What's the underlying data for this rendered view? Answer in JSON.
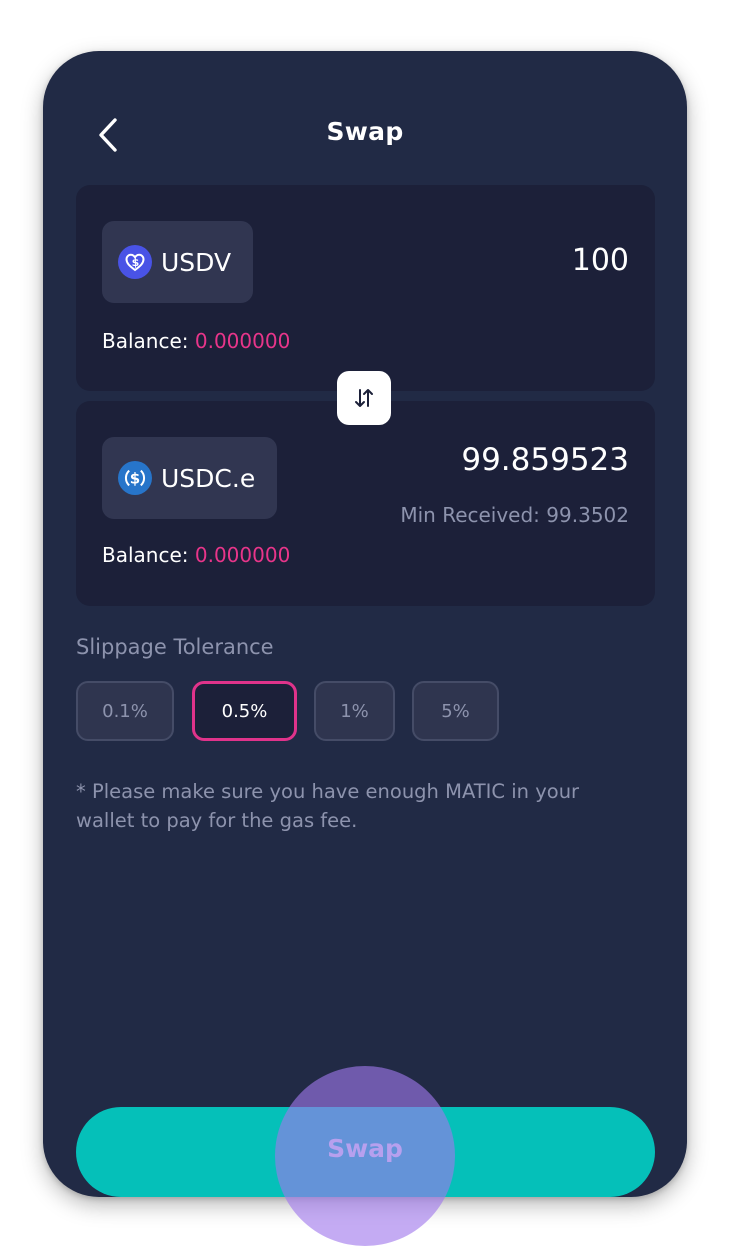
{
  "header": {
    "title": "Swap",
    "back_icon": "chevron-left-icon"
  },
  "from_token": {
    "symbol": "USDV",
    "icon": "usdv-token-icon",
    "amount": "100",
    "balance_label": "Balance:",
    "balance_value": "0.000000"
  },
  "direction_icon": "swap-vertical-arrows-icon",
  "to_token": {
    "symbol": "USDC.e",
    "icon": "usdc-token-icon",
    "amount": "99.859523",
    "min_received": "Min Received: 99.3502",
    "balance_label": "Balance:",
    "balance_value": "0.000000"
  },
  "slippage": {
    "label": "Slippage Tolerance",
    "options": [
      "0.1%",
      "0.5%",
      "1%",
      "5%"
    ],
    "selected": "0.5%"
  },
  "note": "* Please make sure you have enough MATIC in your wallet to pay for the gas fee.",
  "swap_button": {
    "label": "Swap"
  },
  "colors": {
    "background": "#212a45",
    "card": "#1c2039",
    "accent_pink": "#e8358a",
    "swap_button": "#05c0b9",
    "muted_text": "#8d93ad",
    "tap_overlay": "#a078ec"
  }
}
